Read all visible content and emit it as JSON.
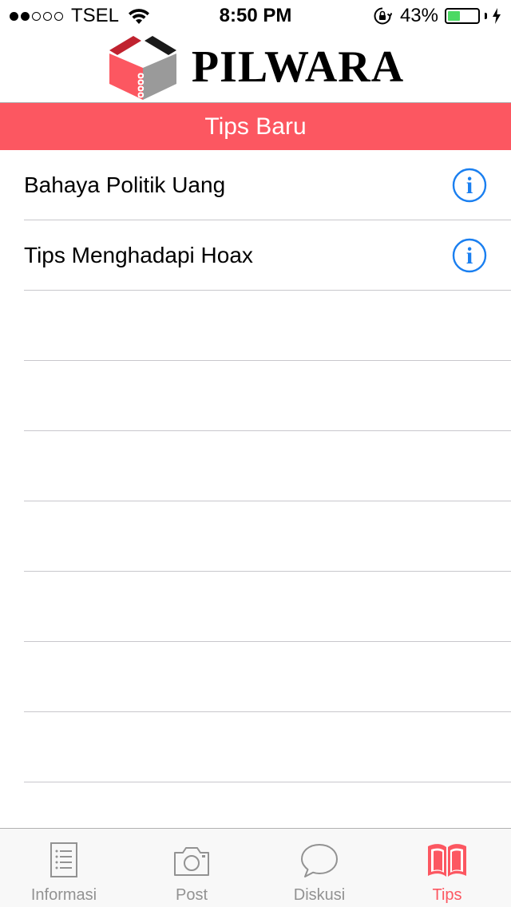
{
  "status_bar": {
    "signal_dots": [
      true,
      true,
      false,
      false,
      false
    ],
    "carrier": "TSEL",
    "time": "8:50 PM",
    "battery_percent": "43%",
    "battery_level": 0.43,
    "battery_color": "#4cd964"
  },
  "header": {
    "brand": "PILWARA"
  },
  "section": {
    "title": "Tips Baru",
    "color": "#fc5761"
  },
  "tips": [
    {
      "title": "Bahaya Politik Uang",
      "icon": "info-icon"
    },
    {
      "title": "Tips Menghadapi Hoax",
      "icon": "info-icon"
    },
    {
      "title": ""
    },
    {
      "title": ""
    },
    {
      "title": ""
    },
    {
      "title": ""
    },
    {
      "title": ""
    },
    {
      "title": ""
    },
    {
      "title": ""
    },
    {
      "title": ""
    }
  ],
  "tab_bar": {
    "tabs": [
      {
        "label": "Informasi",
        "icon": "list-document-icon",
        "active": false
      },
      {
        "label": "Post",
        "icon": "camera-icon",
        "active": false
      },
      {
        "label": "Diskusi",
        "icon": "speech-bubble-icon",
        "active": false
      },
      {
        "label": "Tips",
        "icon": "book-icon",
        "active": true
      }
    ],
    "active_color": "#fc5761",
    "inactive_color": "#929292"
  }
}
